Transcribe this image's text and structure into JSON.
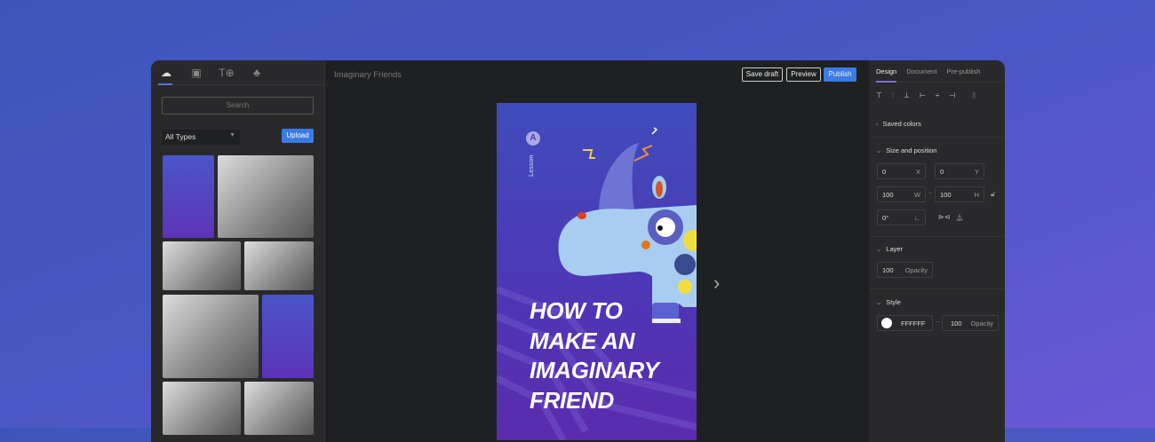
{
  "left_panel": {
    "tabs": [
      {
        "icon": "upload-cloud-icon"
      },
      {
        "icon": "image-icon"
      },
      {
        "icon": "text-add-icon"
      },
      {
        "icon": "shapes-icon"
      }
    ],
    "search_placeholder": "Search",
    "type_filter": "All Types",
    "upload_label": "Upload"
  },
  "editor": {
    "document_title": "Imaginary Friends",
    "save_draft": "Save draft",
    "preview": "Preview",
    "publish": "Publish",
    "page": {
      "lesson_badge": "A",
      "lesson_label": "Lesson",
      "headline": [
        "HOW TO",
        "MAKE AN",
        "IMAGINARY",
        "FRIEND"
      ]
    }
  },
  "right_panel": {
    "tabs": [
      "Design",
      "Document",
      "Pre-publish"
    ],
    "saved_colors": "Saved colors",
    "size_position": {
      "title": "Size and position",
      "x": "0",
      "x_label": "X",
      "y": "0",
      "y_label": "Y",
      "w": "100",
      "w_label": "W",
      "h": "100",
      "h_label": "H",
      "rotation": "0°"
    },
    "layer": {
      "title": "Layer",
      "opacity": "100",
      "opacity_label": "Opacity"
    },
    "style": {
      "title": "Style",
      "color": "FFFFFF",
      "opacity": "100",
      "opacity_label": "Opacity"
    },
    "colors": {
      "accent": "#3b7be4",
      "swatch": "#FFFFFF"
    }
  }
}
